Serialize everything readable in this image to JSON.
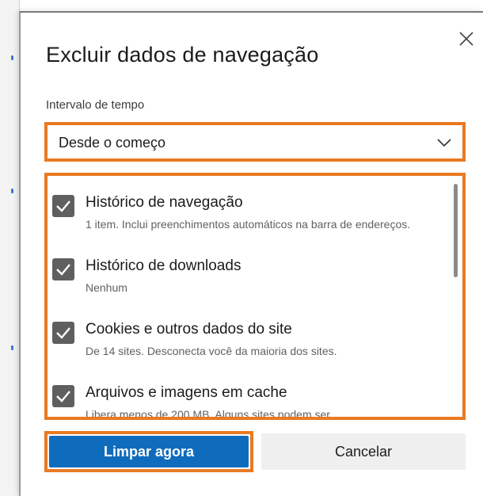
{
  "dialog": {
    "title": "Excluir dados de navegação",
    "close_icon": "close-icon"
  },
  "time_range": {
    "label": "Intervalo de tempo",
    "selected": "Desde o começo",
    "icon": "chevron-down-icon"
  },
  "items": [
    {
      "title": "Histórico de navegação",
      "description": "1 item. Inclui preenchimentos automáticos na barra de endereços.",
      "checked": true
    },
    {
      "title": "Histórico de downloads",
      "description": "Nenhum",
      "checked": true
    },
    {
      "title": "Cookies e outros dados do site",
      "description": "De 14 sites. Desconecta você da maioria dos sites.",
      "checked": true
    },
    {
      "title": "Arquivos e imagens em cache",
      "description": "Libera menos de 200 MB. Alguns sites podem ser",
      "checked": true
    }
  ],
  "buttons": {
    "clear": "Limpar agora",
    "cancel": "Cancelar"
  },
  "colors": {
    "highlight": "#e87a22",
    "primary": "#0f6cbd",
    "checkbox": "#5f5f5f"
  }
}
